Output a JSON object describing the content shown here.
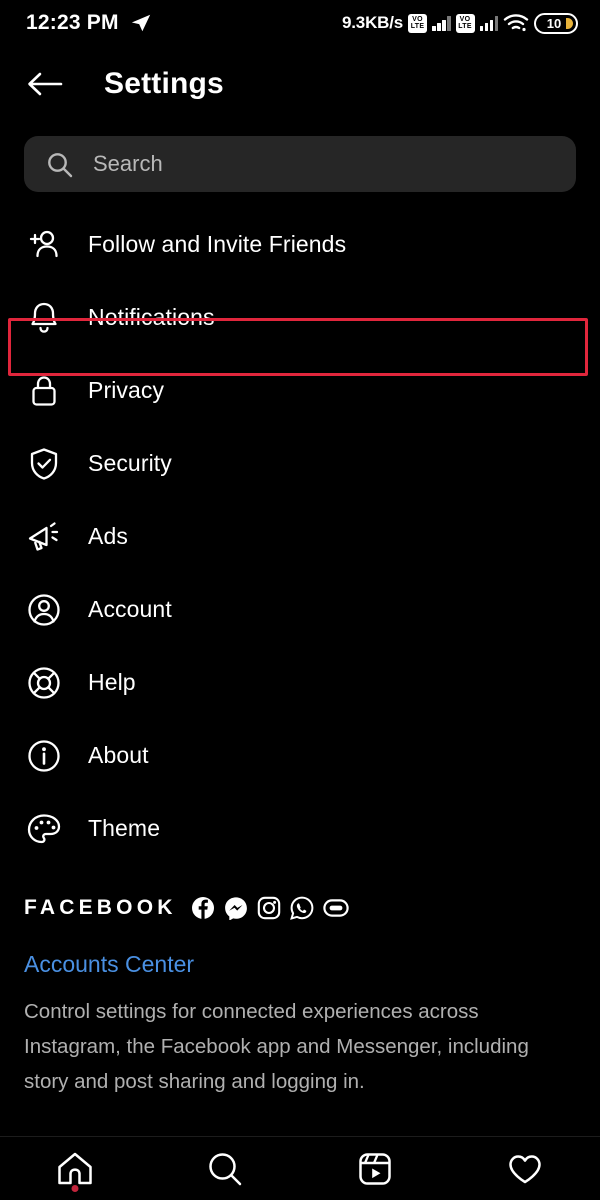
{
  "statusbar": {
    "time": "12:23 PM",
    "location_icon": "navigation-arrow-icon",
    "network_speed": "9.3KB/s",
    "volte_label_top": "VO",
    "volte_label_bottom": "LTE",
    "sim1_icon": "volte-sim1-icon",
    "sim2_icon": "volte-sim2-icon",
    "wifi_icon": "wifi-icon",
    "battery_level": "10"
  },
  "header": {
    "back_icon": "back-arrow-icon",
    "title": "Settings"
  },
  "search": {
    "icon": "search-icon",
    "placeholder": "Search"
  },
  "settings_items": [
    {
      "label": "Follow and Invite Friends",
      "icon": "person-plus-icon"
    },
    {
      "label": "Notifications",
      "icon": "bell-icon",
      "highlighted": true
    },
    {
      "label": "Privacy",
      "icon": "lock-icon"
    },
    {
      "label": "Security",
      "icon": "shield-check-icon"
    },
    {
      "label": "Ads",
      "icon": "megaphone-icon"
    },
    {
      "label": "Account",
      "icon": "person-circle-icon"
    },
    {
      "label": "Help",
      "icon": "life-ring-icon"
    },
    {
      "label": "About",
      "icon": "info-circle-icon"
    },
    {
      "label": "Theme",
      "icon": "palette-icon"
    }
  ],
  "facebook_section": {
    "brand": "FACEBOOK",
    "brand_icons": [
      "facebook-icon",
      "messenger-icon",
      "instagram-icon",
      "whatsapp-icon",
      "portal-icon"
    ],
    "accounts_center_link": "Accounts Center",
    "description": "Control settings for connected experiences across Instagram, the Facebook app and Messenger, including story and post sharing and logging in."
  },
  "bottom_nav": [
    {
      "icon": "home-icon",
      "active": true
    },
    {
      "icon": "search-icon",
      "active": false
    },
    {
      "icon": "reels-icon",
      "active": false
    },
    {
      "icon": "heart-icon",
      "active": false
    }
  ],
  "colors": {
    "background": "#000000",
    "search_field": "#262626",
    "link_blue": "#4a90e2",
    "highlight_red": "#e0263c",
    "battery_fill": "#e8b33a"
  }
}
